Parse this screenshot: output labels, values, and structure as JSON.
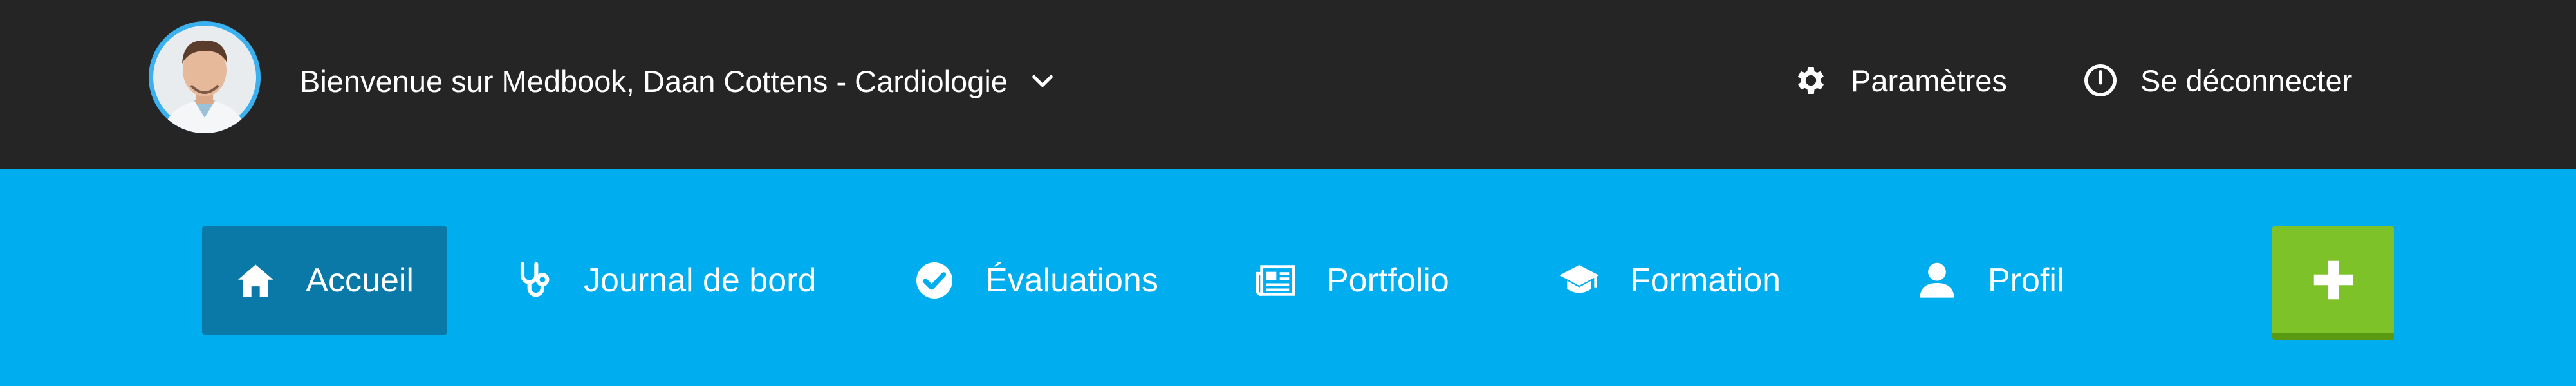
{
  "header": {
    "welcome_text": "Bienvenue sur Medbook, Daan Cottens - Cardiologie",
    "actions": [
      {
        "label": "Paramètres",
        "icon": "gear-icon"
      },
      {
        "label": "Se déconnecter",
        "icon": "power-icon"
      }
    ]
  },
  "nav": {
    "active_index": 0,
    "items": [
      {
        "label": "Accueil",
        "icon": "home-icon"
      },
      {
        "label": "Journal de bord",
        "icon": "stethoscope-icon"
      },
      {
        "label": "Évaluations",
        "icon": "check-circle-icon"
      },
      {
        "label": "Portfolio",
        "icon": "newspaper-icon"
      },
      {
        "label": "Formation",
        "icon": "graduation-cap-icon"
      },
      {
        "label": "Profil",
        "icon": "user-icon"
      }
    ],
    "add_button_icon": "plus-icon"
  },
  "colors": {
    "topbar": "#252525",
    "navbar": "#00adef",
    "active_tab": "#0a79a8",
    "add_button": "#7ec22a"
  }
}
